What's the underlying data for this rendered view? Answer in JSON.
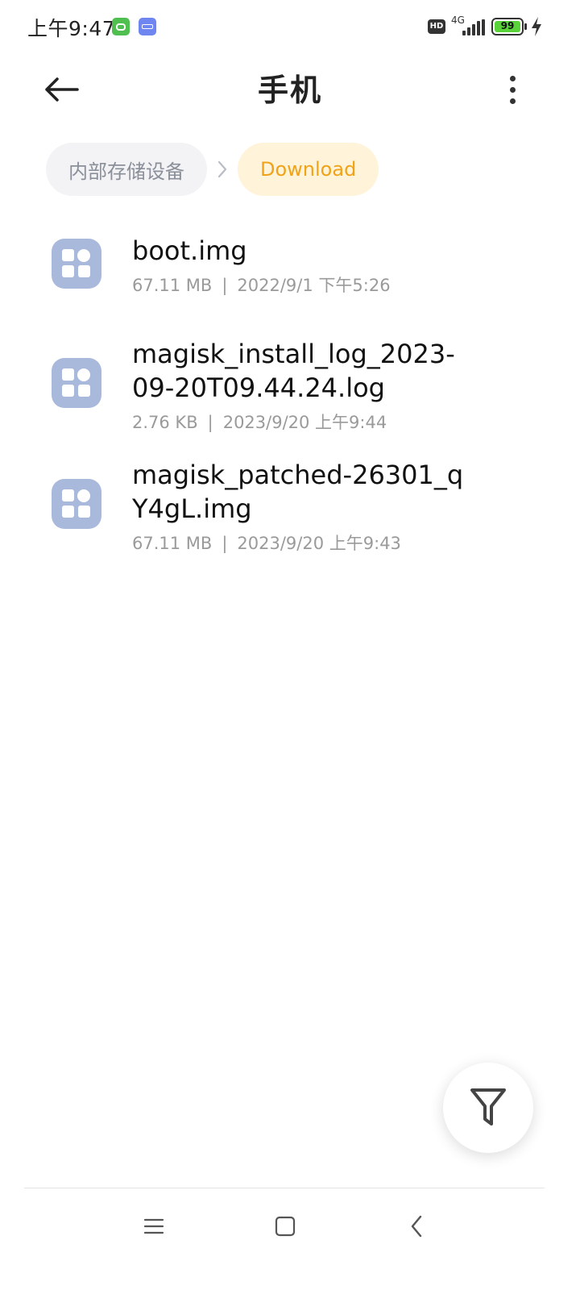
{
  "status_bar": {
    "time": "上午9:47",
    "network": "4G",
    "hd": "HD",
    "battery": "99"
  },
  "header": {
    "title": "手机"
  },
  "breadcrumb": {
    "items": [
      {
        "label": "内部存储设备"
      },
      {
        "label": "Download"
      }
    ]
  },
  "files": [
    {
      "name": "boot.img",
      "size": "67.11 MB",
      "separator": "|",
      "date": "2022/9/1 下午5:26"
    },
    {
      "name": "magisk_install_log_2023-09-20T09.44.24.log",
      "size": "2.76 KB",
      "separator": "|",
      "date": "2023/9/20 上午9:44"
    },
    {
      "name": "magisk_patched-26301_qY4gL.img",
      "size": "67.11 MB",
      "separator": "|",
      "date": "2023/9/20 上午9:43"
    }
  ],
  "colors": {
    "accent": "#f0a318",
    "file_icon": "#a9b9dc",
    "battery": "#5ad33a"
  },
  "icons": [
    "back-arrow-icon",
    "more-vertical-icon",
    "chevron-right-icon",
    "app-file-icon",
    "filter-icon",
    "menu-icon",
    "home-icon",
    "back-icon"
  ]
}
